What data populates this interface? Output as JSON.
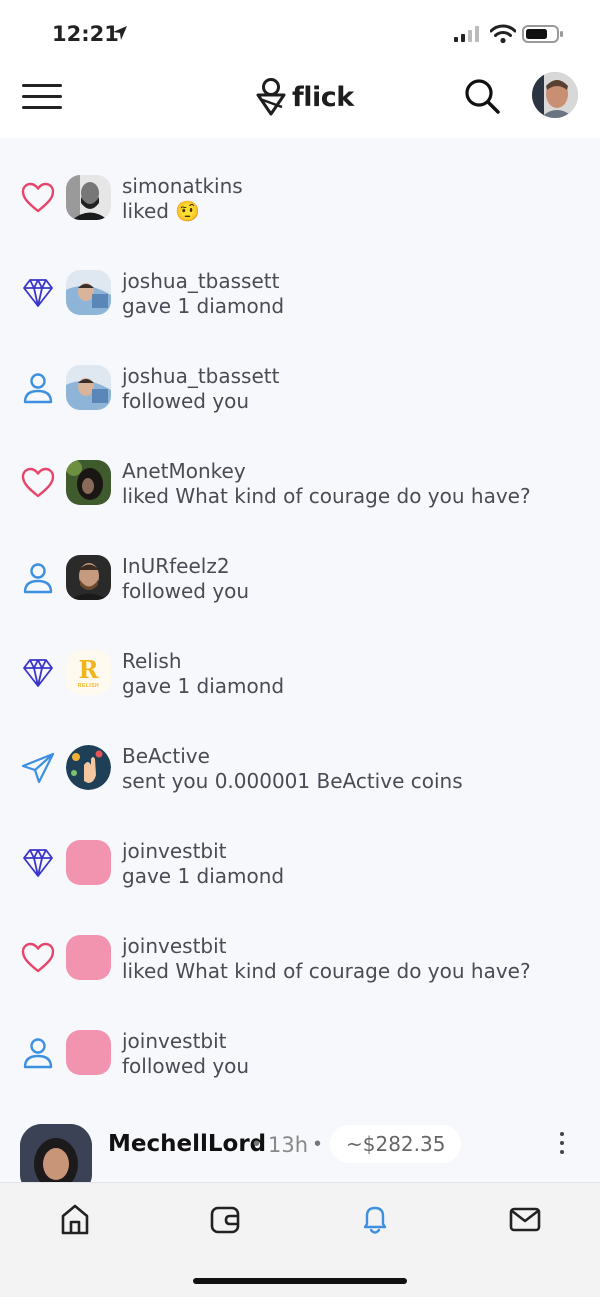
{
  "status_bar": {
    "time": "12:21"
  },
  "header": {
    "logo_text": "flick"
  },
  "notifications": [
    {
      "type": "like",
      "icon": "heart-icon",
      "user": "simonatkins",
      "action": "liked 🤨",
      "avatar": "photo-man-dark"
    },
    {
      "type": "diamond",
      "icon": "diamond-icon",
      "user": "joshua_tbassett",
      "action": "gave 1 diamond",
      "avatar": "photo-man-blue"
    },
    {
      "type": "follow",
      "icon": "person-icon",
      "user": "joshua_tbassett",
      "action": "followed you",
      "avatar": "photo-man-blue"
    },
    {
      "type": "like",
      "icon": "heart-icon",
      "user": "AnetMonkey",
      "action": "liked What kind of courage do you have?",
      "avatar": "photo-woman-dark"
    },
    {
      "type": "follow",
      "icon": "person-icon",
      "user": "InURfeelz2",
      "action": "followed you",
      "avatar": "photo-man-beard"
    },
    {
      "type": "diamond",
      "icon": "diamond-icon",
      "user": "Relish",
      "action": "gave 1 diamond",
      "avatar": "relish-logo",
      "avatar_letter": "R",
      "avatar_sub": "RELISH"
    },
    {
      "type": "sent",
      "icon": "send-icon",
      "user": "BeActive",
      "action": "sent you 0.000001 BeActive coins",
      "avatar": "beactive-logo"
    },
    {
      "type": "diamond",
      "icon": "diamond-icon",
      "user": "joinvestbit",
      "action": "gave 1 diamond",
      "avatar": "pink-placeholder"
    },
    {
      "type": "like",
      "icon": "heart-icon",
      "user": "joinvestbit",
      "action": "liked What kind of courage do you have?",
      "avatar": "pink-placeholder"
    },
    {
      "type": "follow",
      "icon": "person-icon",
      "user": "joinvestbit",
      "action": "followed you",
      "avatar": "pink-placeholder"
    }
  ],
  "post_preview": {
    "author": "MechellLord",
    "separator": "•",
    "time": "13h",
    "value": "~$282.35"
  },
  "colors": {
    "heart": "#e5466b",
    "diamond": "#3a36c9",
    "person": "#3d8fe0",
    "send": "#3d8fe0",
    "active_nav": "#3d8fe0",
    "pink_placeholder": "#f294b0"
  }
}
